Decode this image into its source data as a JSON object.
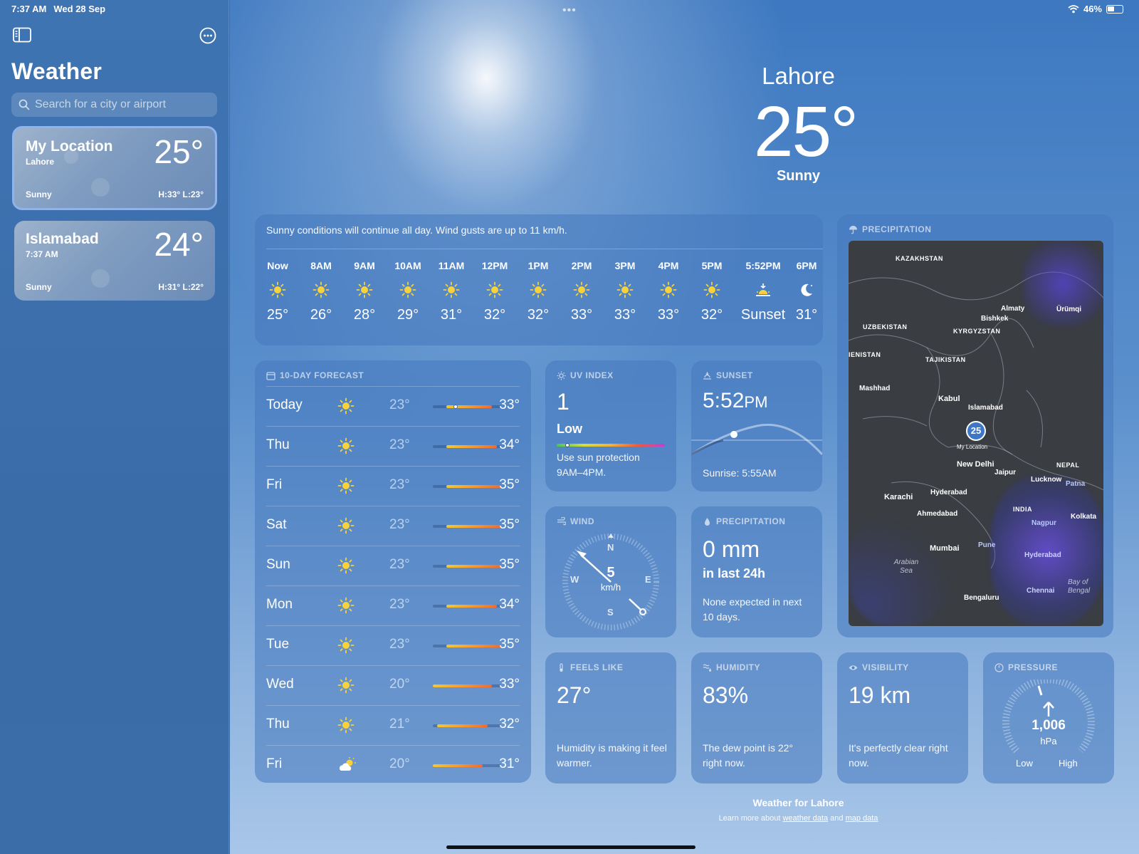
{
  "status": {
    "time": "7:37 AM",
    "date": "Wed 28 Sep",
    "battery": "46%"
  },
  "sidebar": {
    "title": "Weather",
    "search_placeholder": "Search for a city or airport",
    "locations": [
      {
        "name": "My Location",
        "sub": "Lahore",
        "temp": "25°",
        "cond": "Sunny",
        "hl": "H:33°  L:23°"
      },
      {
        "name": "Islamabad",
        "sub": "7:37 AM",
        "temp": "24°",
        "cond": "Sunny",
        "hl": "H:31°  L:22°"
      }
    ]
  },
  "hero": {
    "city": "Lahore",
    "temp": "25°",
    "cond": "Sunny"
  },
  "hourly": {
    "summary": "Sunny conditions will continue all day. Wind gusts are up to 11 km/h.",
    "hours": [
      {
        "t": "Now",
        "v": "25°",
        "icon": "sun-icon"
      },
      {
        "t": "8AM",
        "v": "26°",
        "icon": "sun-icon"
      },
      {
        "t": "9AM",
        "v": "28°",
        "icon": "sun-icon"
      },
      {
        "t": "10AM",
        "v": "29°",
        "icon": "sun-icon"
      },
      {
        "t": "11AM",
        "v": "31°",
        "icon": "sun-icon"
      },
      {
        "t": "12PM",
        "v": "32°",
        "icon": "sun-icon"
      },
      {
        "t": "1PM",
        "v": "32°",
        "icon": "sun-icon"
      },
      {
        "t": "2PM",
        "v": "33°",
        "icon": "sun-icon"
      },
      {
        "t": "3PM",
        "v": "33°",
        "icon": "sun-icon"
      },
      {
        "t": "4PM",
        "v": "33°",
        "icon": "sun-icon"
      },
      {
        "t": "5PM",
        "v": "32°",
        "icon": "sun-icon"
      },
      {
        "t": "5:52PM",
        "v": "Sunset",
        "icon": "sunset-icon"
      },
      {
        "t": "6PM",
        "v": "31°",
        "icon": "moon-icon"
      }
    ]
  },
  "tenday": {
    "title": "10-DAY FORECAST",
    "scale": [
      20,
      35
    ],
    "days": [
      {
        "day": "Today",
        "lo": "23°",
        "hi": "33°",
        "lo_n": 23,
        "hi_n": 33,
        "now_n": 25,
        "icon": "sun-icon"
      },
      {
        "day": "Thu",
        "lo": "23°",
        "hi": "34°",
        "lo_n": 23,
        "hi_n": 34,
        "icon": "sun-icon"
      },
      {
        "day": "Fri",
        "lo": "23°",
        "hi": "35°",
        "lo_n": 23,
        "hi_n": 35,
        "icon": "sun-icon"
      },
      {
        "day": "Sat",
        "lo": "23°",
        "hi": "35°",
        "lo_n": 23,
        "hi_n": 35,
        "icon": "sun-icon"
      },
      {
        "day": "Sun",
        "lo": "23°",
        "hi": "35°",
        "lo_n": 23,
        "hi_n": 35,
        "icon": "sun-icon"
      },
      {
        "day": "Mon",
        "lo": "23°",
        "hi": "34°",
        "lo_n": 23,
        "hi_n": 34,
        "icon": "sun-icon"
      },
      {
        "day": "Tue",
        "lo": "23°",
        "hi": "35°",
        "lo_n": 23,
        "hi_n": 35,
        "icon": "sun-icon"
      },
      {
        "day": "Wed",
        "lo": "20°",
        "hi": "33°",
        "lo_n": 20,
        "hi_n": 33,
        "icon": "sun-icon"
      },
      {
        "day": "Thu",
        "lo": "21°",
        "hi": "32°",
        "lo_n": 21,
        "hi_n": 32,
        "icon": "sun-icon"
      },
      {
        "day": "Fri",
        "lo": "20°",
        "hi": "31°",
        "lo_n": 20,
        "hi_n": 31,
        "icon": "partly-cloudy-icon"
      }
    ]
  },
  "uv": {
    "title": "UV INDEX",
    "value": "1",
    "level": "Low",
    "level_frac": 0.1,
    "note": "Use sun protection 9AM–4PM."
  },
  "sunset": {
    "title": "SUNSET",
    "time": "5:52",
    "ampm": "PM",
    "sunrise": "Sunrise: 5:55AM"
  },
  "wind": {
    "title": "WIND",
    "speed": "5",
    "unit": "km/h",
    "n": "N",
    "e": "E",
    "s": "S",
    "w": "W"
  },
  "precip": {
    "title": "PRECIPITATION",
    "value": "0 mm",
    "period": "in last 24h",
    "note": "None expected in next 10 days."
  },
  "map": {
    "title": "PRECIPITATION",
    "pin": "25",
    "pin_label": "My Location",
    "labels": {
      "kazakhstan": "KAZAKHSTAN",
      "uzbekistan": "UZBEKISTAN",
      "kyrgyzstan": "KYRGYZSTAN",
      "tajikistan": "TAJIKISTAN",
      "turkmenistan": "IENISTAN",
      "nepal": "NEPAL",
      "india": "INDIA",
      "almaty": "Almaty",
      "bishkek": "Bishkek",
      "urumqi": "Ürümqi",
      "mashhad": "Mashhad",
      "kabul": "Kabul",
      "islamabad": "Islamabad",
      "newdelhi": "New Delhi",
      "jaipur": "Jaipur",
      "lucknow": "Lucknow",
      "patna": "Patna",
      "karachi": "Karachi",
      "hyderabad_pk": "Hyderabad",
      "ahmedabad": "Ahmedabad",
      "nagpur": "Nagpur",
      "kolkata": "Kolkata",
      "mumbai": "Mumbai",
      "pune": "Pune",
      "hyderabad_in": "Hyderabad",
      "arabian_sea": "Arabian Sea",
      "bengaluru": "Bengaluru",
      "chennai": "Chennai",
      "bay": "Bay of Bengal"
    }
  },
  "feels": {
    "title": "FEELS LIKE",
    "value": "27°",
    "note": "Humidity is making it feel warmer."
  },
  "humidity": {
    "title": "HUMIDITY",
    "value": "83%",
    "note": "The dew point is 22° right now."
  },
  "visibility": {
    "title": "VISIBILITY",
    "value": "19 km",
    "note": "It's perfectly clear right now."
  },
  "pressure": {
    "title": "PRESSURE",
    "value": "1,006",
    "unit": "hPa",
    "low": "Low",
    "high": "High"
  },
  "footer": {
    "title": "Weather for Lahore",
    "learn": "Learn more about",
    "weather_link": "weather data",
    "and": "and",
    "map_link": "map data"
  }
}
